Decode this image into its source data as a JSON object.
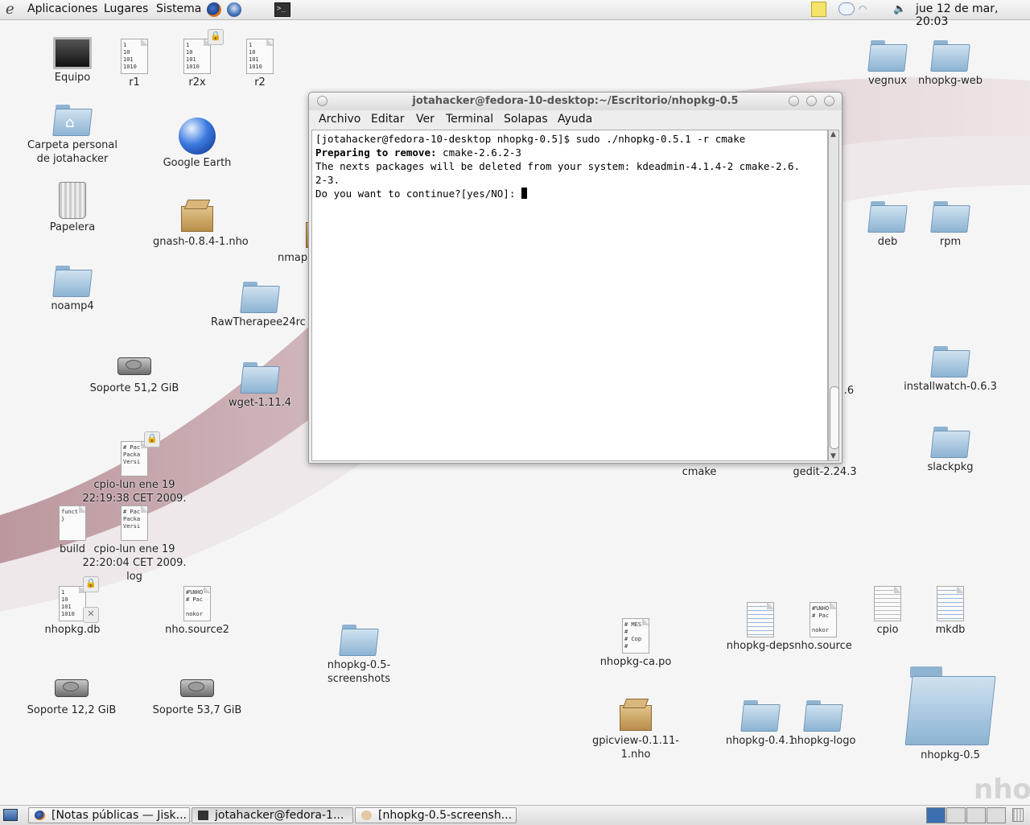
{
  "top_panel": {
    "menus": [
      "Aplicaciones",
      "Lugares",
      "Sistema"
    ],
    "clock": "jue 12 de mar, 20:03"
  },
  "desktop_icons": {
    "equipo": "Equipo",
    "r1": "r1",
    "r2x": "r2x",
    "r2": "r2",
    "carpeta": "Carpeta personal de jotahacker",
    "google_earth": "Google Earth",
    "papelera": "Papelera",
    "gnash": "gnash-0.8.4-1.nho",
    "nmap": "nmap",
    "noamp4": "noamp4",
    "rawtherapee": "RawTherapee24rc",
    "soporte51": "Soporte 51,2 GiB",
    "wget": "wget-1.11.4",
    "cpio_lun1": "cpio-lun ene 19 22:19:38 CET 2009.",
    "build": "build",
    "cpio_lun2": "cpio-lun ene 19 22:20:04 CET 2009. log",
    "nhopkg_db": "nhopkg.db",
    "nho_source2": "nho.source2",
    "screenshots": "nhopkg-0.5-screenshots",
    "soporte12": "Soporte 12,2 GiB",
    "soporte53": "Soporte 53,7 GiB",
    "nhopkg_ca": "nhopkg-ca.po",
    "gpicview": "gpicview-0.1.11-1.nho",
    "vegnux": "vegnux",
    "nhopkg_web": "nhopkg-web",
    "deb": "deb",
    "rpm": "rpm",
    "partial_06": ".6",
    "installwatch": "installwatch-0.6.3",
    "cmake": "cmake",
    "gedit": "gedit-2.24.3",
    "slackpkg": "slackpkg",
    "nhopkg_deps": "nhopkg-deps",
    "nho_source": "nho.source",
    "cpio": "cpio",
    "mkdb": "mkdb",
    "nhopkg_041": "nhopkg-0.4.1",
    "nhopkg_logo": "nhopkg-logo",
    "nhopkg_05": "nhopkg-0.5"
  },
  "doc_snippets": {
    "binary": "1\n10\n101\n1010",
    "pac": "# Pac\nPacka\nVersi",
    "funct": "funct\n}",
    "nho": "#%NHO\n# Pac\n\nnokor",
    "po": "# MES\n#\n# Cop\n#"
  },
  "terminal": {
    "title": "jotahacker@fedora-10-desktop:~/Escritorio/nhopkg-0.5",
    "menus": [
      "Archivo",
      "Editar",
      "Ver",
      "Terminal",
      "Solapas",
      "Ayuda"
    ],
    "line1": "[jotahacker@fedora-10-desktop nhopkg-0.5]$ sudo ./nhopkg-0.5.1 -r cmake",
    "line2_bold": "Preparing to remove:",
    "line2_rest": " cmake-2.6.2-3",
    "line3": "The nexts packages will be deleted from your system: kdeadmin-4.1.4-2 cmake-2.6.",
    "line4": "2-3.",
    "line5": "Do you want to continue?[yes/NO]: "
  },
  "taskbar": {
    "tasks": [
      "[Notas públicas — Jisk...",
      "jotahacker@fedora-1...",
      "[nhopkg-0.5-screensh..."
    ]
  },
  "watermark": "nho"
}
